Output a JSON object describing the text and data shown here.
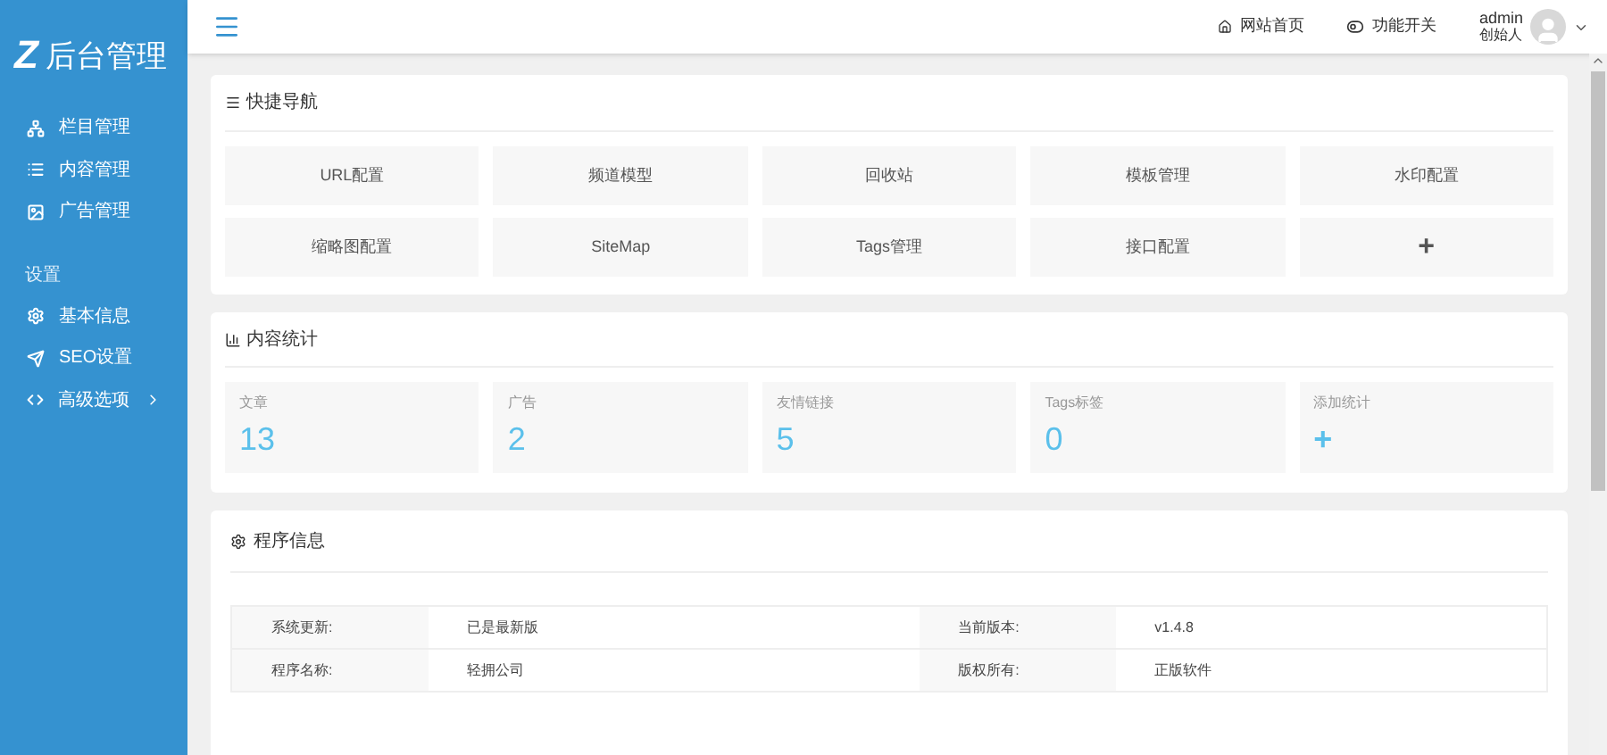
{
  "sidebar": {
    "logo_mark": "Z",
    "logo_text": "后台管理",
    "sections": [
      {
        "items": [
          {
            "label": "栏目管理",
            "has_children": false
          },
          {
            "label": "内容管理",
            "has_children": false
          },
          {
            "label": "广告管理",
            "has_children": false
          }
        ]
      },
      {
        "heading": "设置",
        "items": [
          {
            "label": "基本信息",
            "has_children": false
          },
          {
            "label": "SEO设置",
            "has_children": false
          },
          {
            "label": "高级选项",
            "has_children": true
          }
        ]
      }
    ]
  },
  "header": {
    "links": [
      {
        "label": "网站首页"
      },
      {
        "label": "功能开关"
      }
    ],
    "user": {
      "name": "admin",
      "role": "创始人"
    }
  },
  "quick_nav": {
    "title": "快捷导航",
    "tiles": [
      {
        "label": "URL配置",
        "kind": "link"
      },
      {
        "label": "频道模型",
        "kind": "link"
      },
      {
        "label": "回收站",
        "kind": "link"
      },
      {
        "label": "模板管理",
        "kind": "link"
      },
      {
        "label": "水印配置",
        "kind": "link"
      },
      {
        "label": "缩略图配置",
        "kind": "link"
      },
      {
        "label": "SiteMap",
        "kind": "link"
      },
      {
        "label": "Tags管理",
        "kind": "link"
      },
      {
        "label": "接口配置",
        "kind": "link"
      },
      {
        "label": "+",
        "kind": "add"
      }
    ]
  },
  "stats": {
    "title": "内容统计",
    "items": [
      {
        "label": "文章",
        "value": "13",
        "kind": "count"
      },
      {
        "label": "广告",
        "value": "2",
        "kind": "count"
      },
      {
        "label": "友情链接",
        "value": "5",
        "kind": "count"
      },
      {
        "label": "Tags标签",
        "value": "0",
        "kind": "count"
      },
      {
        "label": "添加统计",
        "value": "+",
        "kind": "add"
      }
    ]
  },
  "program_info": {
    "title": "程序信息",
    "rows": [
      [
        {
          "label": "系统更新:",
          "value": "已是最新版"
        },
        {
          "label": "当前版本:",
          "value": "v1.4.8"
        }
      ],
      [
        {
          "label": "程序名称:",
          "value": "轻拥公司"
        },
        {
          "label": "版权所有:",
          "value": "正版软件"
        }
      ]
    ]
  }
}
